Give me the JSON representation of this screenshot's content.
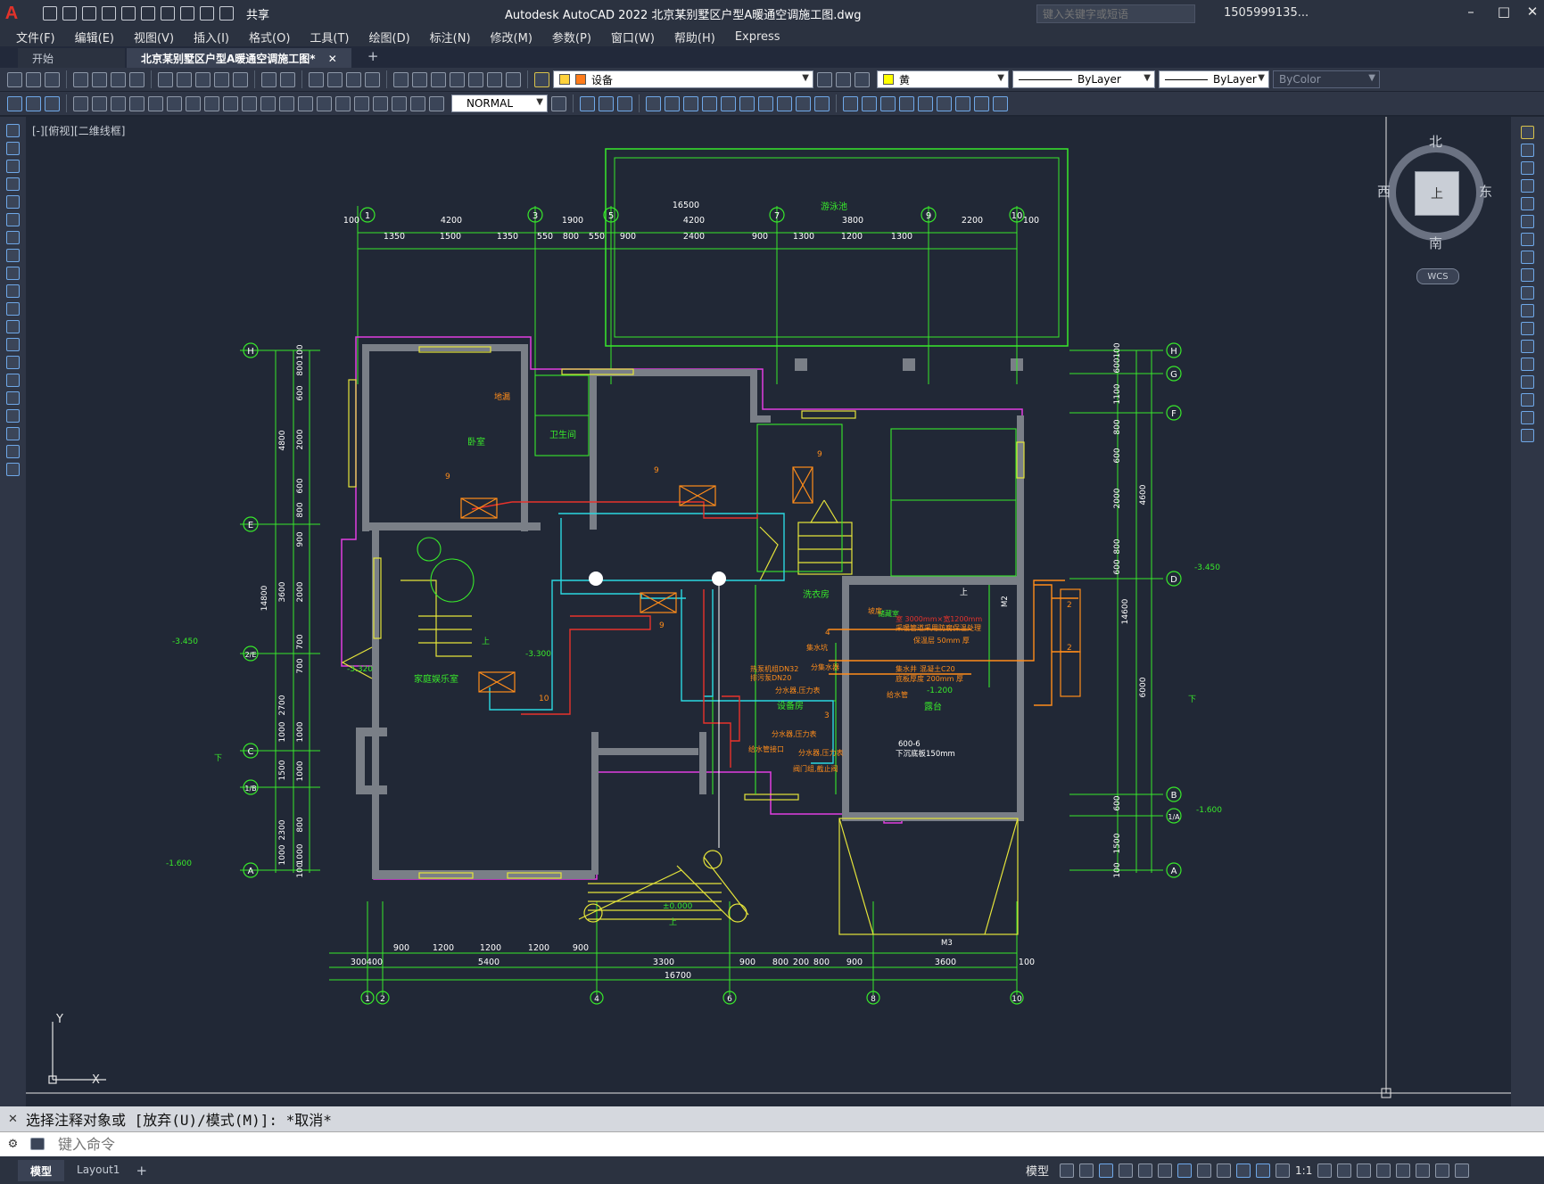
{
  "app": {
    "window_title": "Autodesk AutoCAD 2022    北京某别墅区户型A暖通空调施工图.dwg",
    "share_label": "共享",
    "search_placeholder": "键入关键字或短语",
    "user": "1505999135...",
    "logo_letter": "A"
  },
  "menu": [
    "文件(F)",
    "编辑(E)",
    "视图(V)",
    "插入(I)",
    "格式(O)",
    "工具(T)",
    "绘图(D)",
    "标注(N)",
    "修改(M)",
    "参数(P)",
    "窗口(W)",
    "帮助(H)",
    "Express"
  ],
  "tabs": {
    "start": "开始",
    "drawing": "北京某别墅区户型A暖通空调施工图*"
  },
  "toolbar": {
    "layer": "设备",
    "color": "黄",
    "color_hex": "#ffff00",
    "linetype": "ByLayer",
    "lineweight": "ByLayer",
    "plotstyle": "ByColor",
    "dimstyle": "NORMAL"
  },
  "viewport": {
    "label": "[-][俯视][二维线框]",
    "cube_face": "上",
    "north": "北",
    "south": "南",
    "east": "东",
    "west": "西",
    "wcs": "WCS"
  },
  "drawing": {
    "top_axes": [
      "1",
      "3",
      "5",
      "7",
      "9",
      "10"
    ],
    "bottom_axes": [
      "1",
      "2",
      "4",
      "6",
      "8",
      "10"
    ],
    "left_axes": [
      "H",
      "E",
      "2/E",
      "C",
      "1/B",
      "A"
    ],
    "right_axes": [
      "H",
      "G",
      "F",
      "D",
      "B",
      "1/A",
      "A"
    ],
    "top_dim_total": "16500",
    "top_dims_row1": [
      "100",
      "4200",
      "1900",
      "4200",
      "3800",
      "2200",
      "100"
    ],
    "top_dims_row2": [
      "1350",
      "1500",
      "1350",
      "550",
      "800",
      "550",
      "900",
      "2400",
      "900",
      "1300",
      "1200",
      "1300"
    ],
    "bottom_dims_row1": [
      "900",
      "1200",
      "1200",
      "1200",
      "900"
    ],
    "bottom_dims_row2": [
      "300",
      "400",
      "5400",
      "3300",
      "900",
      "800",
      "200",
      "800",
      "900",
      "3600",
      "100"
    ],
    "bottom_dim_total": "16700",
    "left_dim_total": "14800",
    "left_dims_outer": [
      "4800",
      "3600",
      "2700",
      "1000",
      "1500",
      "2300",
      "1000"
    ],
    "left_dims_inner": [
      "100",
      "800",
      "600",
      "2000",
      "600",
      "800",
      "900",
      "2000",
      "700",
      "700",
      "1000",
      "1000",
      "800",
      "1000",
      "100"
    ],
    "right_dim_total": "14600",
    "right_dims_outer": [
      "4600",
      "6000"
    ],
    "right_dims_inner": [
      "100",
      "600",
      "1100",
      "800",
      "600",
      "2000",
      "800",
      "600",
      "600",
      "1500",
      "100"
    ],
    "rooms": [
      "卧室",
      "卫生间",
      "家庭娱乐室",
      "设备房",
      "洗衣房",
      "露台",
      "游泳池",
      "储藏室"
    ],
    "notes": [
      "地漏",
      "9",
      "9",
      "9",
      "9",
      "10",
      "2",
      "2",
      "3",
      "4",
      "600-6",
      "下沉底板150mm",
      "-3.450",
      "-3.450",
      "-3.320",
      "-3.300",
      "-1.200",
      "-1.600",
      "-1.600",
      "±0.000",
      "M3",
      "M2",
      "上",
      "下",
      "下",
      "上",
      "坡度",
      "集水坑",
      "给水管接口"
    ],
    "equipment_notes": [
      "室 3000mm×宽1200mm",
      "采暖管道采用防腐保温处理",
      "保温层 50mm 厚",
      "热泵机组DN32",
      "排污泵DN20",
      "分集水器",
      "分水器,压力表",
      "给水管",
      "集水井",
      "混凝土C20",
      "底板厚度 200mm 厚",
      "阀门组,截止阀",
      "分水器,压力表",
      "分水器,压力表"
    ]
  },
  "command": {
    "history": "选择注释对象或 [放弃(U)/模式(M)]: *取消*",
    "placeholder": "键入命令"
  },
  "status": {
    "model_tab": "模型",
    "layout_tab": "Layout1",
    "model_label": "模型",
    "scale": "1:1"
  }
}
